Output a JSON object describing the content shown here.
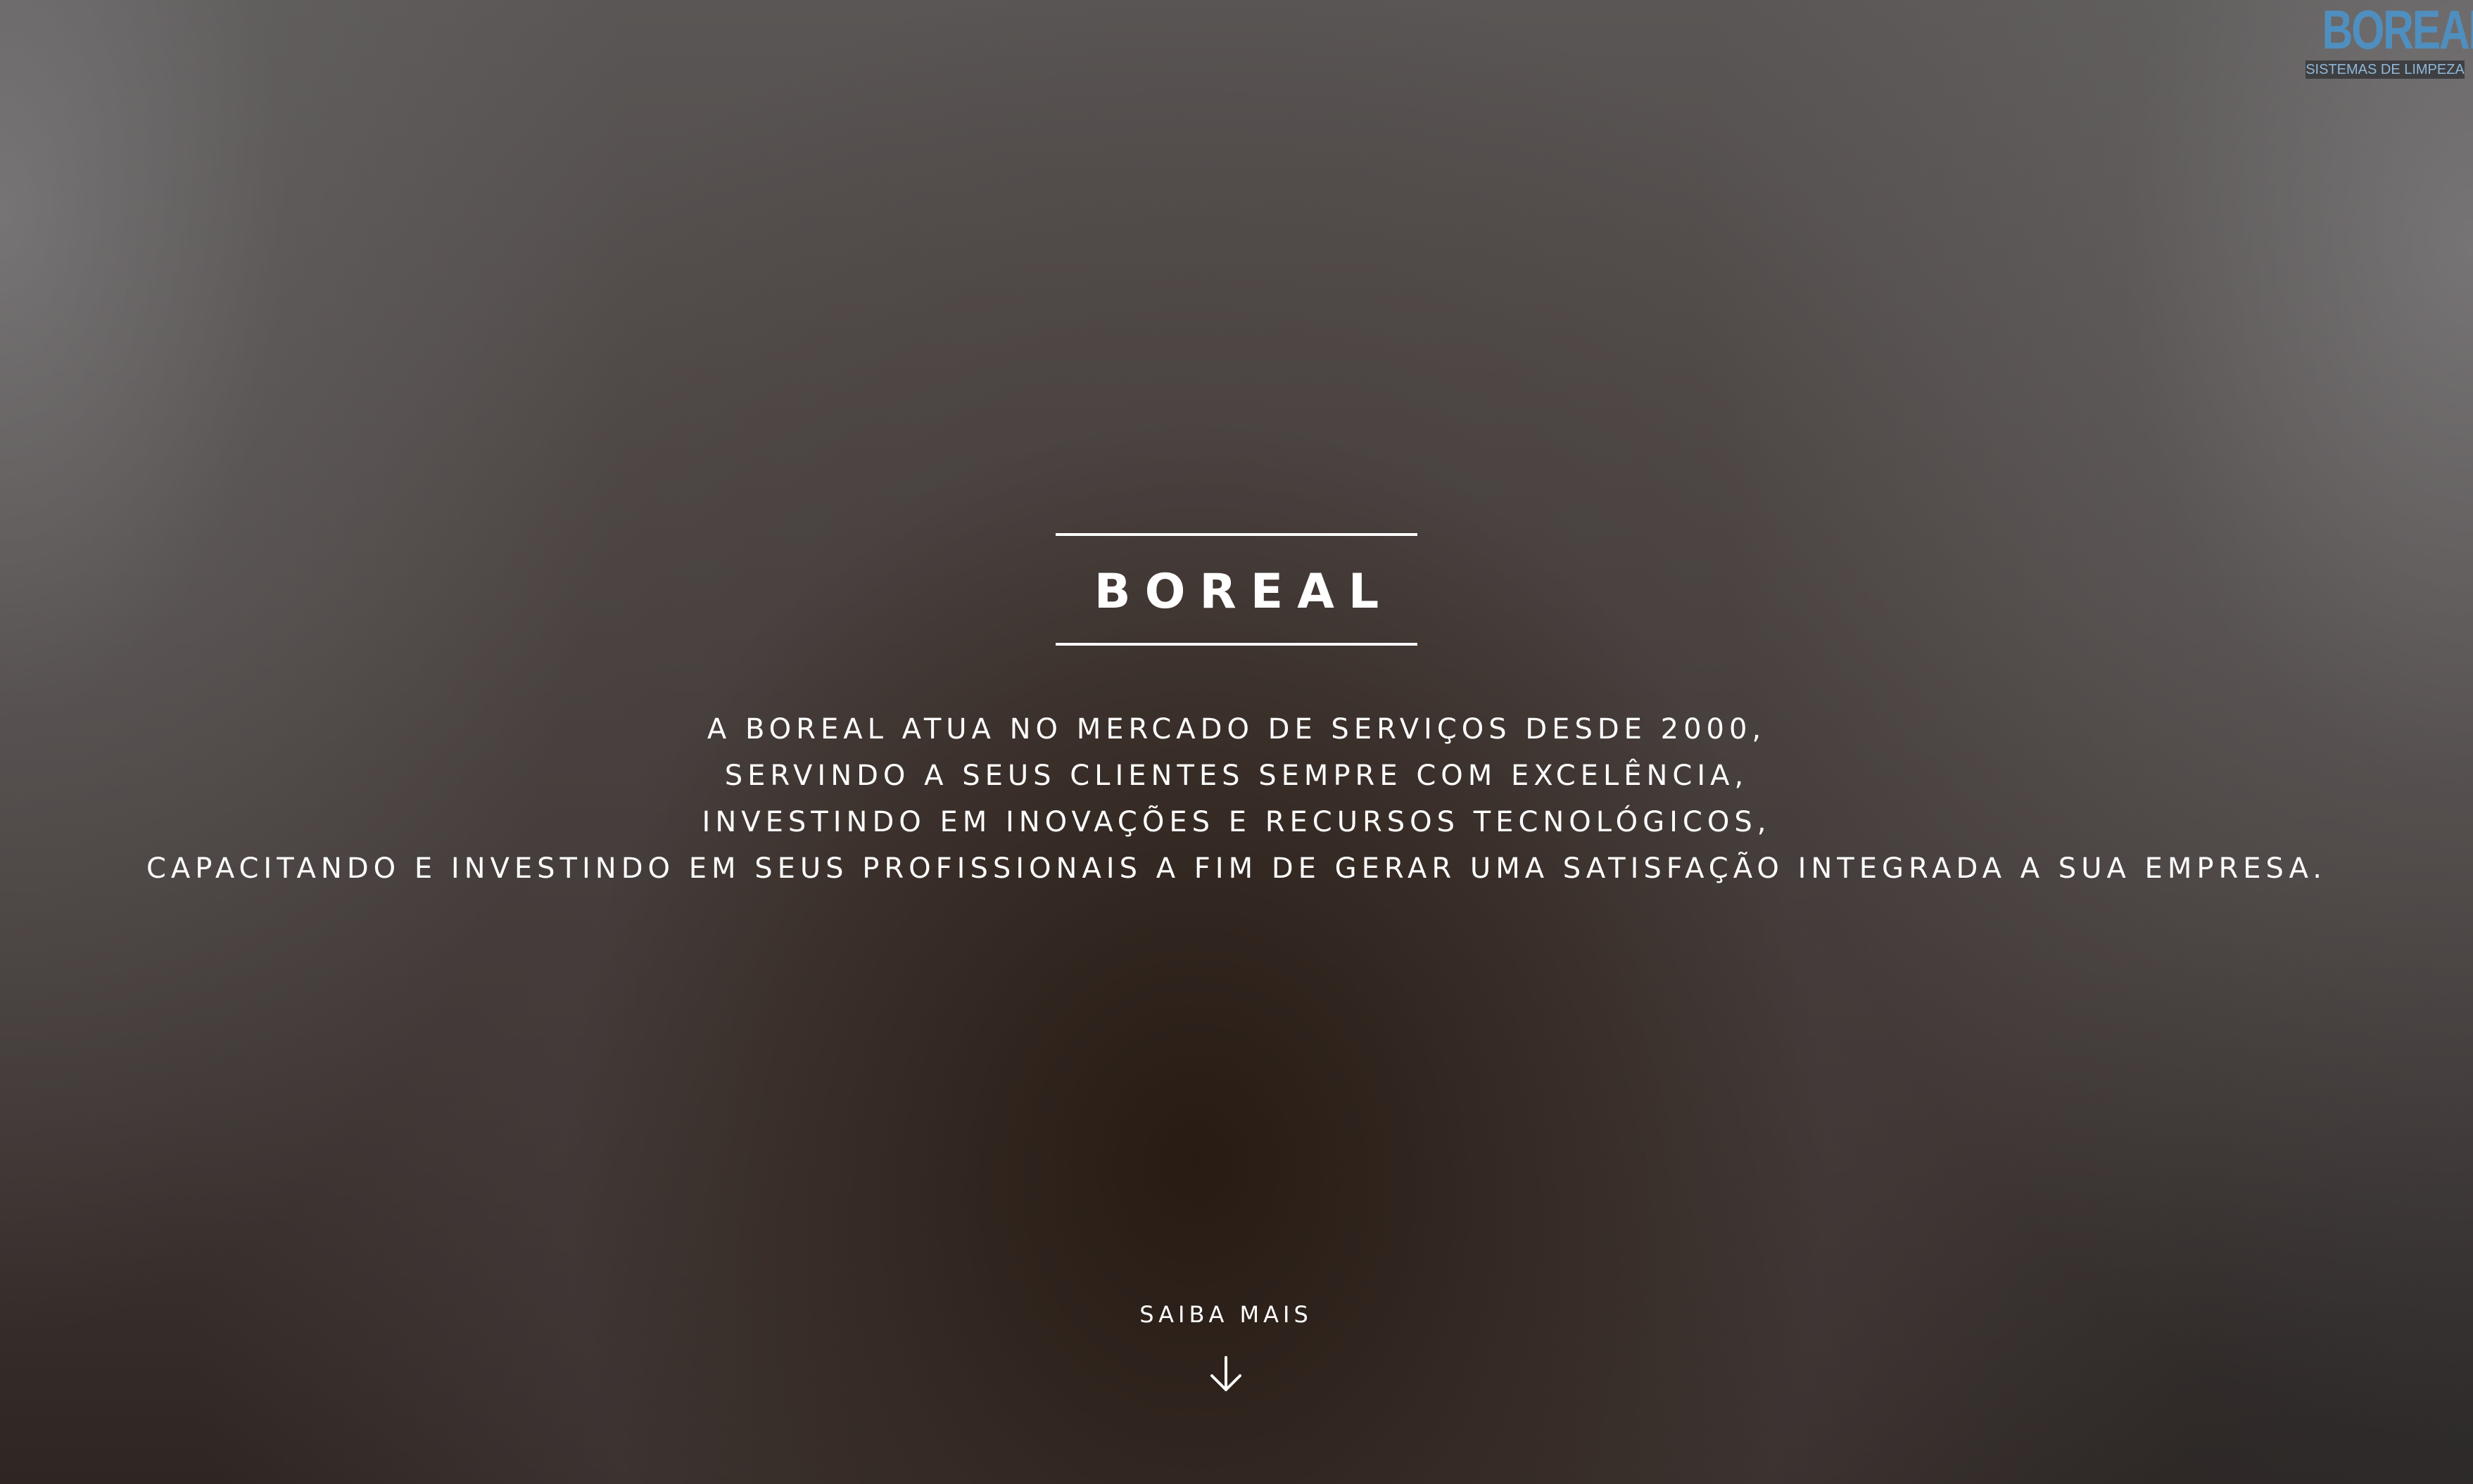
{
  "logo": {
    "word": "BOREAL",
    "tagline": "SISTEMAS DE LIMPEZA",
    "colors": {
      "word": "#4f8fbf",
      "tag_bg": "#3f3f42"
    }
  },
  "hero": {
    "title": "BOREAL",
    "description_lines": [
      "A BOREAL ATUA NO MERCADO DE SERVIÇOS DESDE 2000,",
      "SERVINDO A SEUS CLIENTES SEMPRE COM EXCELÊNCIA,",
      "INVESTINDO EM INOVAÇÕES E RECURSOS TECNOLÓGICOS,",
      "CAPACITANDO E INVESTINDO EM SEUS PROFISSIONAIS A FIM DE GERAR UMA SATISFAÇÃO INTEGRADA A SUA EMPRESA."
    ]
  },
  "cta": {
    "label": "SAIBA MAIS",
    "icon": "arrow-down-icon"
  }
}
